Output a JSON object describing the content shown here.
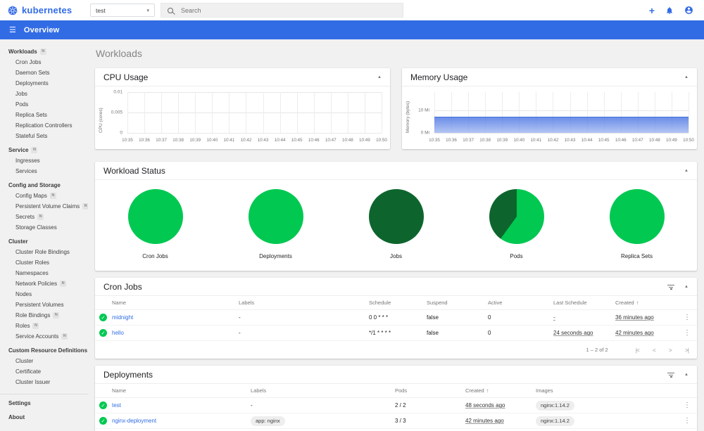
{
  "colors": {
    "brand_blue": "#326ce5",
    "success_green": "#00c851",
    "dark_green": "#0d652d",
    "chart_blue": "#4472de"
  },
  "icons": {
    "menu": "☰",
    "add": "+",
    "select_caret": "▾",
    "caret_up": "▲",
    "sort_asc": "↑",
    "kebab": "⋮",
    "check": "✓",
    "page_first": "|<",
    "page_prev": "<",
    "page_next": ">",
    "page_last": ">|"
  },
  "topbar": {
    "logo_text": "kubernetes",
    "namespace_value": "test",
    "search_placeholder": "Search"
  },
  "nav": {
    "title": "Overview"
  },
  "page_title": "Workloads",
  "sidebar": {
    "items": [
      {
        "label": "Workloads",
        "type": "parent",
        "badge": "N"
      },
      {
        "label": "Cron Jobs",
        "type": "child"
      },
      {
        "label": "Daemon Sets",
        "type": "child"
      },
      {
        "label": "Deployments",
        "type": "child"
      },
      {
        "label": "Jobs",
        "type": "child"
      },
      {
        "label": "Pods",
        "type": "child"
      },
      {
        "label": "Replica Sets",
        "type": "child"
      },
      {
        "label": "Replication Controllers",
        "type": "child"
      },
      {
        "label": "Stateful Sets",
        "type": "child"
      },
      {
        "label": "Service",
        "type": "parent",
        "badge": "N"
      },
      {
        "label": "Ingresses",
        "type": "child"
      },
      {
        "label": "Services",
        "type": "child"
      },
      {
        "label": "Config and Storage",
        "type": "parent"
      },
      {
        "label": "Config Maps",
        "type": "child",
        "badge": "N"
      },
      {
        "label": "Persistent Volume Claims",
        "type": "child",
        "badge": "N"
      },
      {
        "label": "Secrets",
        "type": "child",
        "badge": "N"
      },
      {
        "label": "Storage Classes",
        "type": "child"
      },
      {
        "label": "Cluster",
        "type": "parent"
      },
      {
        "label": "Cluster Role Bindings",
        "type": "child"
      },
      {
        "label": "Cluster Roles",
        "type": "child"
      },
      {
        "label": "Namespaces",
        "type": "child"
      },
      {
        "label": "Network Policies",
        "type": "child",
        "badge": "N"
      },
      {
        "label": "Nodes",
        "type": "child"
      },
      {
        "label": "Persistent Volumes",
        "type": "child"
      },
      {
        "label": "Role Bindings",
        "type": "child",
        "badge": "N"
      },
      {
        "label": "Roles",
        "type": "child",
        "badge": "N"
      },
      {
        "label": "Service Accounts",
        "type": "child",
        "badge": "N"
      },
      {
        "label": "Custom Resource Definitions",
        "type": "parent"
      },
      {
        "label": "Cluster",
        "type": "child"
      },
      {
        "label": "Certificate",
        "type": "child"
      },
      {
        "label": "Cluster Issuer",
        "type": "child"
      },
      {
        "divider": true
      },
      {
        "label": "Settings",
        "type": "parent"
      },
      {
        "label": "About",
        "type": "parent"
      }
    ]
  },
  "cpu_chart": {
    "title": "CPU Usage",
    "ylabel": "CPU (cores)",
    "yticks": [
      {
        "label": "0.01",
        "pos": 0
      },
      {
        "label": "0.005",
        "pos": 50
      },
      {
        "label": "0",
        "pos": 100
      }
    ],
    "xticks": [
      "10:35",
      "10:36",
      "10:37",
      "10:38",
      "10:39",
      "10:40",
      "10:41",
      "10:42",
      "10:43",
      "10:44",
      "10:45",
      "10:46",
      "10:47",
      "10:48",
      "10:49",
      "10:50"
    ]
  },
  "memory_chart": {
    "title": "Memory Usage",
    "ylabel": "Memory (bytes)",
    "yticks": [
      {
        "label": "10 Mi",
        "pos": 44
      },
      {
        "label": "0 Mi",
        "pos": 100
      }
    ],
    "xticks": [
      "10:35",
      "10:36",
      "10:37",
      "10:38",
      "10:39",
      "10:40",
      "10:41",
      "10:42",
      "10:43",
      "10:44",
      "10:45",
      "10:46",
      "10:47",
      "10:48",
      "10:49",
      "10:50"
    ],
    "area_height_pct": 40
  },
  "workload_status": {
    "title": "Workload Status",
    "pies": [
      {
        "label": "Cron Jobs",
        "segments": [
          {
            "color": "#00c851",
            "deg": 360
          }
        ]
      },
      {
        "label": "Deployments",
        "segments": [
          {
            "color": "#00c851",
            "deg": 360
          }
        ]
      },
      {
        "label": "Jobs",
        "segments": [
          {
            "color": "#0d652d",
            "deg": 360
          }
        ]
      },
      {
        "label": "Pods",
        "segments": [
          {
            "color": "#00c851",
            "deg": 216
          },
          {
            "color": "#0d652d",
            "deg": 144
          }
        ]
      },
      {
        "label": "Replica Sets",
        "segments": [
          {
            "color": "#00c851",
            "deg": 360
          }
        ]
      }
    ]
  },
  "cronjobs_table": {
    "title": "Cron Jobs",
    "columns": [
      {
        "label": "Name"
      },
      {
        "label": "Labels"
      },
      {
        "label": "Schedule"
      },
      {
        "label": "Suspend"
      },
      {
        "label": "Active"
      },
      {
        "label": "Last Schedule"
      },
      {
        "label": "Created",
        "sort": "asc"
      }
    ],
    "rows": [
      {
        "cells": [
          {
            "t": "link",
            "v": "midnight"
          },
          {
            "t": "text",
            "v": "-"
          },
          {
            "t": "text",
            "v": "0 0 * * *"
          },
          {
            "t": "text",
            "v": "false"
          },
          {
            "t": "text",
            "v": "0"
          },
          {
            "t": "ago",
            "v": "-"
          },
          {
            "t": "ago",
            "v": "36 minutes ago"
          }
        ]
      },
      {
        "cells": [
          {
            "t": "link",
            "v": "hello"
          },
          {
            "t": "text",
            "v": "-"
          },
          {
            "t": "text",
            "v": "*/1 * * * *"
          },
          {
            "t": "text",
            "v": "false"
          },
          {
            "t": "text",
            "v": "0"
          },
          {
            "t": "ago",
            "v": "24 seconds ago"
          },
          {
            "t": "ago",
            "v": "42 minutes ago"
          }
        ]
      }
    ],
    "pagination": "1 – 2 of 2"
  },
  "deployments_table": {
    "title": "Deployments",
    "columns": [
      {
        "label": "Name"
      },
      {
        "label": "Labels"
      },
      {
        "label": "Pods"
      },
      {
        "label": "Created",
        "sort": "asc"
      },
      {
        "label": "Images"
      }
    ],
    "rows": [
      {
        "cells": [
          {
            "t": "link",
            "v": "test"
          },
          {
            "t": "text",
            "v": "-"
          },
          {
            "t": "text",
            "v": "2 / 2"
          },
          {
            "t": "ago",
            "v": "48 seconds ago"
          },
          {
            "t": "chip",
            "v": "nginx:1.14.2"
          }
        ]
      },
      {
        "cells": [
          {
            "t": "link",
            "v": "nginx-deployment"
          },
          {
            "t": "chip",
            "v": "app: nginx"
          },
          {
            "t": "text",
            "v": "3 / 3"
          },
          {
            "t": "ago",
            "v": "42 minutes ago"
          },
          {
            "t": "chip",
            "v": "nginx:1.14.2"
          }
        ]
      }
    ]
  },
  "chart_data": [
    {
      "type": "line",
      "title": "CPU Usage",
      "ylabel": "CPU (cores)",
      "ylim": [
        0,
        0.01
      ],
      "ytick_labels": [
        "0",
        "0.005",
        "0.01"
      ],
      "x": [
        "10:35",
        "10:36",
        "10:37",
        "10:38",
        "10:39",
        "10:40",
        "10:41",
        "10:42",
        "10:43",
        "10:44",
        "10:45",
        "10:46",
        "10:47",
        "10:48",
        "10:49",
        "10:50"
      ],
      "series": [],
      "grid": true,
      "note": "no visible series"
    },
    {
      "type": "area",
      "title": "Memory Usage",
      "ylabel": "Memory (bytes)",
      "ytick_labels": [
        "0 Mi",
        "10 Mi"
      ],
      "x": [
        "10:35",
        "10:36",
        "10:37",
        "10:38",
        "10:39",
        "10:40",
        "10:41",
        "10:42",
        "10:43",
        "10:44",
        "10:45",
        "10:46",
        "10:47",
        "10:48",
        "10:49",
        "10:50"
      ],
      "series": [
        {
          "name": "memory",
          "values_mi": [
            8,
            8,
            8,
            8,
            8,
            8,
            8,
            8,
            8,
            8,
            8,
            8,
            8,
            8,
            8,
            8
          ]
        }
      ],
      "grid": true
    },
    {
      "type": "pie",
      "title": "Workload Status",
      "charts": [
        {
          "label": "Cron Jobs",
          "slices": [
            {
              "fraction": 1.0,
              "color": "#00c851"
            }
          ]
        },
        {
          "label": "Deployments",
          "slices": [
            {
              "fraction": 1.0,
              "color": "#00c851"
            }
          ]
        },
        {
          "label": "Jobs",
          "slices": [
            {
              "fraction": 1.0,
              "color": "#0d652d"
            }
          ]
        },
        {
          "label": "Pods",
          "slices": [
            {
              "fraction": 0.6,
              "color": "#00c851"
            },
            {
              "fraction": 0.4,
              "color": "#0d652d"
            }
          ]
        },
        {
          "label": "Replica Sets",
          "slices": [
            {
              "fraction": 1.0,
              "color": "#00c851"
            }
          ]
        }
      ]
    }
  ]
}
